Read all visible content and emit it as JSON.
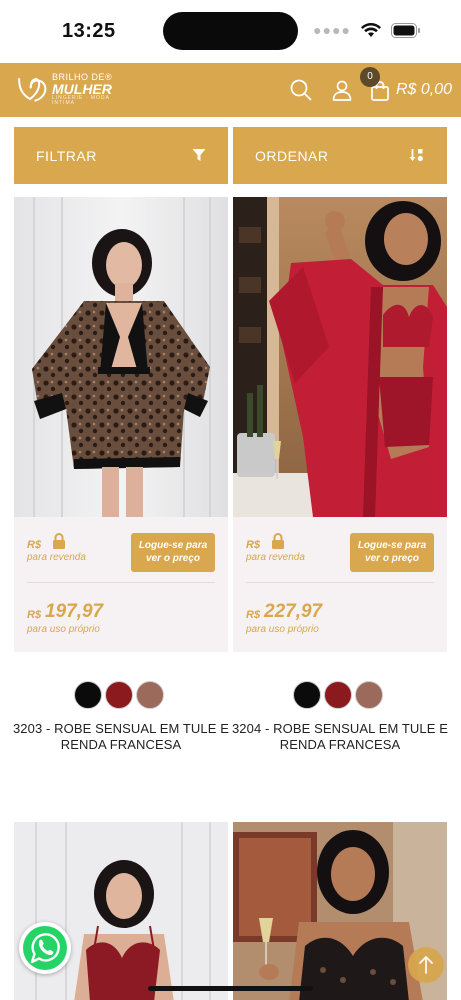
{
  "status_bar": {
    "time": "13:25"
  },
  "header": {
    "logo": {
      "line1": "BRILHO DE®",
      "line2": "MULHER",
      "line3": "LINGERIE · MODA INTIMA"
    },
    "cart_count": "0",
    "cart_total": "R$ 0,00"
  },
  "toolbar": {
    "filter_label": "FILTRAR",
    "sort_label": "ORDENAR"
  },
  "products": [
    {
      "rs": "R$",
      "resale_label": "para revenda",
      "login_label": "Logue-se para ver o preço",
      "currency": "R$",
      "price": "197,97",
      "own_use_label": "para uso próprio",
      "title": "3203 - ROBE SENSUAL EM TULE E RENDA FRANCESA",
      "swatches": [
        "#0b0b0b",
        "#8b1a1f",
        "#9b6a5a"
      ]
    },
    {
      "rs": "R$",
      "resale_label": "para revenda",
      "login_label": "Logue-se para ver o preço",
      "currency": "R$",
      "price": "227,97",
      "own_use_label": "para uso próprio",
      "title": "3204 - ROBE SENSUAL EM TULE E RENDA FRANCESA",
      "swatches": [
        "#0b0b0b",
        "#8b1a1f",
        "#9b6a5a"
      ]
    }
  ],
  "colors": {
    "accent": "#d8a74e",
    "price_bg": "#f6f1f3",
    "whatsapp": "#25d366"
  }
}
